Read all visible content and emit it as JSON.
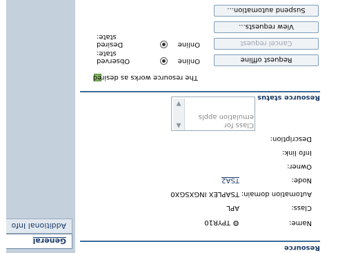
{
  "nav": {
    "general": "General",
    "additional_info": "Additional Info"
  },
  "resource": {
    "section_title": "Resource",
    "name_label": "Name:",
    "name_value": "TPYR10",
    "name_icon": "gear-icon",
    "class_label": "Class:",
    "class_value": "APL",
    "automation_domain_label": "Automation domain:",
    "automation_domain_value": "TSAPLEX INGXSGX0",
    "node_label": "Node:",
    "node_value": "TSA2",
    "owner_label": "Owner:",
    "info_link_label": "Info link:",
    "description_label": "Description:",
    "description_value": "Class for emulation appls"
  },
  "status": {
    "section_title": "Resource status",
    "works_text": "The resource works as desired",
    "observed_label": "Observed state:",
    "observed_value": "Online",
    "desired_label": "Desired state:",
    "desired_value": "Online"
  },
  "buttons": {
    "request_offline": "Request offline",
    "cancel_request": "Cancel request",
    "view_requests": "View requests...",
    "suspend_automation": "Suspend automation..."
  },
  "colors": {
    "sidebar": "#c4d0dc",
    "accent": "#3b6a99",
    "status_ok": "#8dc36b"
  }
}
